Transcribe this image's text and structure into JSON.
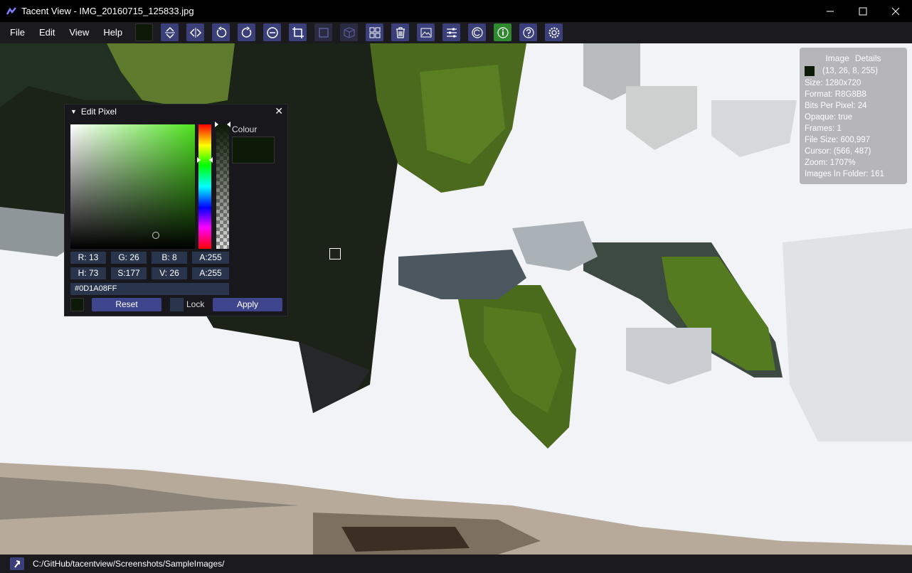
{
  "window": {
    "title": "Tacent View - IMG_20160715_125833.jpg",
    "minimize_icon": "minimize-icon",
    "maximize_icon": "maximize-icon",
    "close_icon": "close-icon"
  },
  "menu": {
    "items": [
      "File",
      "Edit",
      "View",
      "Help"
    ]
  },
  "toolbar": {
    "buttons": [
      {
        "name": "current-colour-swatch",
        "color": "#0d1a08"
      },
      {
        "name": "flip-vertical-icon"
      },
      {
        "name": "flip-horizontal-icon"
      },
      {
        "name": "rotate-anticlockwise-icon"
      },
      {
        "name": "rotate-clockwise-icon"
      },
      {
        "name": "zoom-out-icon"
      },
      {
        "name": "crop-icon"
      },
      {
        "name": "tile-icon"
      },
      {
        "name": "cube-icon"
      },
      {
        "name": "contact-sheet-icon"
      },
      {
        "name": "delete-icon"
      },
      {
        "name": "image-icon"
      },
      {
        "name": "adjust-icon"
      },
      {
        "name": "refresh-icon"
      },
      {
        "name": "info-icon"
      },
      {
        "name": "help-icon"
      },
      {
        "name": "settings-icon"
      }
    ]
  },
  "edit_pixel": {
    "title": "Edit Pixel",
    "colour_label": "Colour",
    "colour_value": "#0d1a08",
    "rgba": {
      "r": "R: 13",
      "g": "G: 26",
      "b": "B:  8",
      "a": "A:255"
    },
    "hsva": {
      "h": "H: 73",
      "s": "S:177",
      "v": "V: 26",
      "a": "A:255"
    },
    "hex": "#0D1A08FF",
    "reset_label": "Reset",
    "lock_label": "Lock",
    "apply_label": "Apply"
  },
  "image_details": {
    "title_a": "Image",
    "title_b": "Details",
    "pixel": "(13, 26, 8, 255)",
    "size": "Size: 1280x720",
    "format": "Format: R8G8B8",
    "bpp": "Bits Per Pixel: 24",
    "opaque": "Opaque: true",
    "frames": "Frames: 1",
    "file_size": "File Size: 600,997",
    "cursor": "Cursor: (566, 487)",
    "zoom": "Zoom: 1707%",
    "images_in_folder": "Images In Folder: 161"
  },
  "status": {
    "path": "C:/GitHub/tacentview/Screenshots/SampleImages/"
  },
  "colors": {
    "toolbar_active": "#3a3f7a",
    "field_bg": "#29354d",
    "button_bg": "#3e458d",
    "pixel_colour": "#0d1a08"
  }
}
